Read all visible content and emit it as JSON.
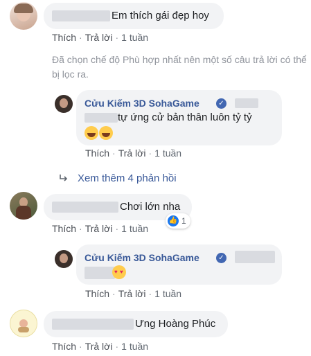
{
  "comments": [
    {
      "text": "Em thích gái đẹp hoy",
      "actions": {
        "like": "Thích",
        "reply": "Trả lời",
        "time": "1 tuần"
      }
    },
    {
      "text": "Chơi lớn nha",
      "actions": {
        "like": "Thích",
        "reply": "Trả lời",
        "time": "1 tuần"
      },
      "reaction_count": "1"
    },
    {
      "text": "Ưng Hoàng Phúc",
      "actions": {
        "like": "Thích",
        "reply": "Trả lời",
        "time": "1 tuần"
      }
    }
  ],
  "filter_notice": "Đã chọn chế độ Phù hợp nhất nên một số câu trả lời có thể bị lọc ra.",
  "replies": [
    {
      "author": "Cửu Kiếm 3D SohaGame",
      "text": "tự ứng cử bản thân luôn tỷ tỷ",
      "actions": {
        "like": "Thích",
        "reply": "Trả lời",
        "time": "1 tuần"
      }
    },
    {
      "author": "Cửu Kiếm 3D SohaGame",
      "actions": {
        "like": "Thích",
        "reply": "Trả lời",
        "time": "1 tuần"
      }
    }
  ],
  "view_more": "Xem thêm 4 phản hồi",
  "colors": {
    "link": "#385898",
    "bubble": "#f2f3f5",
    "verified": "#4267b2",
    "muted": "#90949c"
  },
  "icons": [
    "verified-icon",
    "reply-arrow-icon",
    "like-icon",
    "laughing-emoji-icon",
    "heart-eyes-emoji-icon"
  ]
}
